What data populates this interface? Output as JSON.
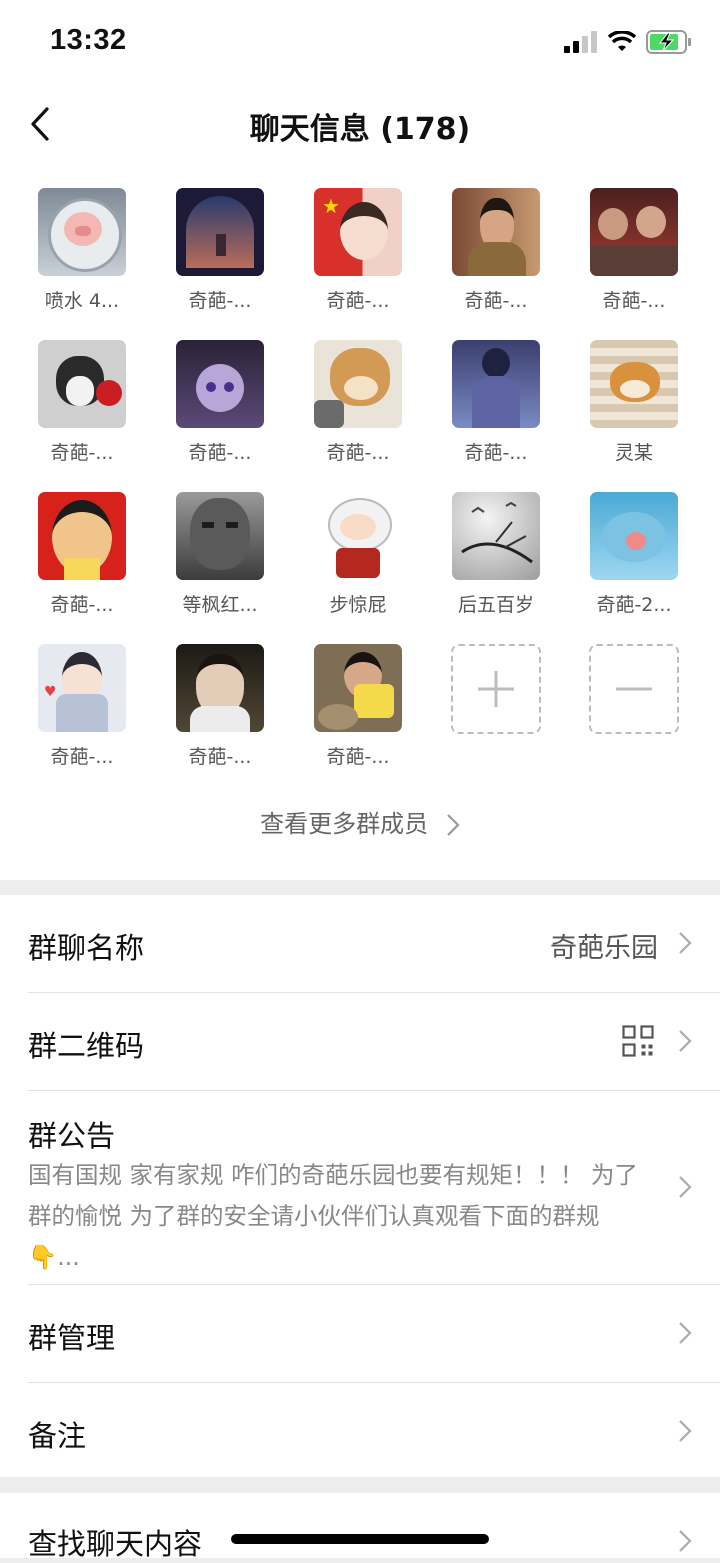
{
  "status_bar": {
    "time": "13:32"
  },
  "nav": {
    "title": "聊天信息 (178)"
  },
  "members": [
    {
      "name": "喷水 4...",
      "avatar": "pig-in-washer"
    },
    {
      "name": "奇葩-...",
      "avatar": "night-window"
    },
    {
      "name": "奇葩-...",
      "avatar": "girl-with-flag"
    },
    {
      "name": "奇葩-...",
      "avatar": "man-portrait"
    },
    {
      "name": "奇葩-...",
      "avatar": "christmas-people"
    },
    {
      "name": "奇葩-...",
      "avatar": "husky-with-rose"
    },
    {
      "name": "奇葩-...",
      "avatar": "anime-girl-purple"
    },
    {
      "name": "奇葩-...",
      "avatar": "shiba-dog"
    },
    {
      "name": "奇葩-...",
      "avatar": "boy-blue-night"
    },
    {
      "name": "灵某",
      "avatar": "shiba-in-blanket"
    },
    {
      "name": "奇葩-...",
      "avatar": "cartoon-face-red"
    },
    {
      "name": "等枫红...",
      "avatar": "man-bw-portrait"
    },
    {
      "name": "步惊屁",
      "avatar": "inuyasha-cartoon"
    },
    {
      "name": "后五百岁",
      "avatar": "birds-ink"
    },
    {
      "name": "奇葩-2...",
      "avatar": "blue-fish"
    },
    {
      "name": "奇葩-...",
      "avatar": "anime-boy-heart"
    },
    {
      "name": "奇葩-...",
      "avatar": "boy-night-selfie"
    },
    {
      "name": "奇葩-...",
      "avatar": "child-on-ground"
    }
  ],
  "add_member_icon": "plus-icon",
  "remove_member_icon": "minus-icon",
  "view_more": "查看更多群成员",
  "settings": {
    "group_name_label": "群聊名称",
    "group_name_value": "奇葩乐园",
    "qrcode_label": "群二维码",
    "notice_label": "群公告",
    "notice_text": "国有国规 家有家规 咋们的奇葩乐园也要有规矩！！！ 为了群的愉悦 为了群的安全请小伙伴们认真观看下面的群规 👇...",
    "manage_label": "群管理",
    "remark_label": "备注"
  },
  "search": {
    "label": "查找聊天内容"
  },
  "colors": {
    "background": "#ededed",
    "battery": "#4cd964"
  }
}
